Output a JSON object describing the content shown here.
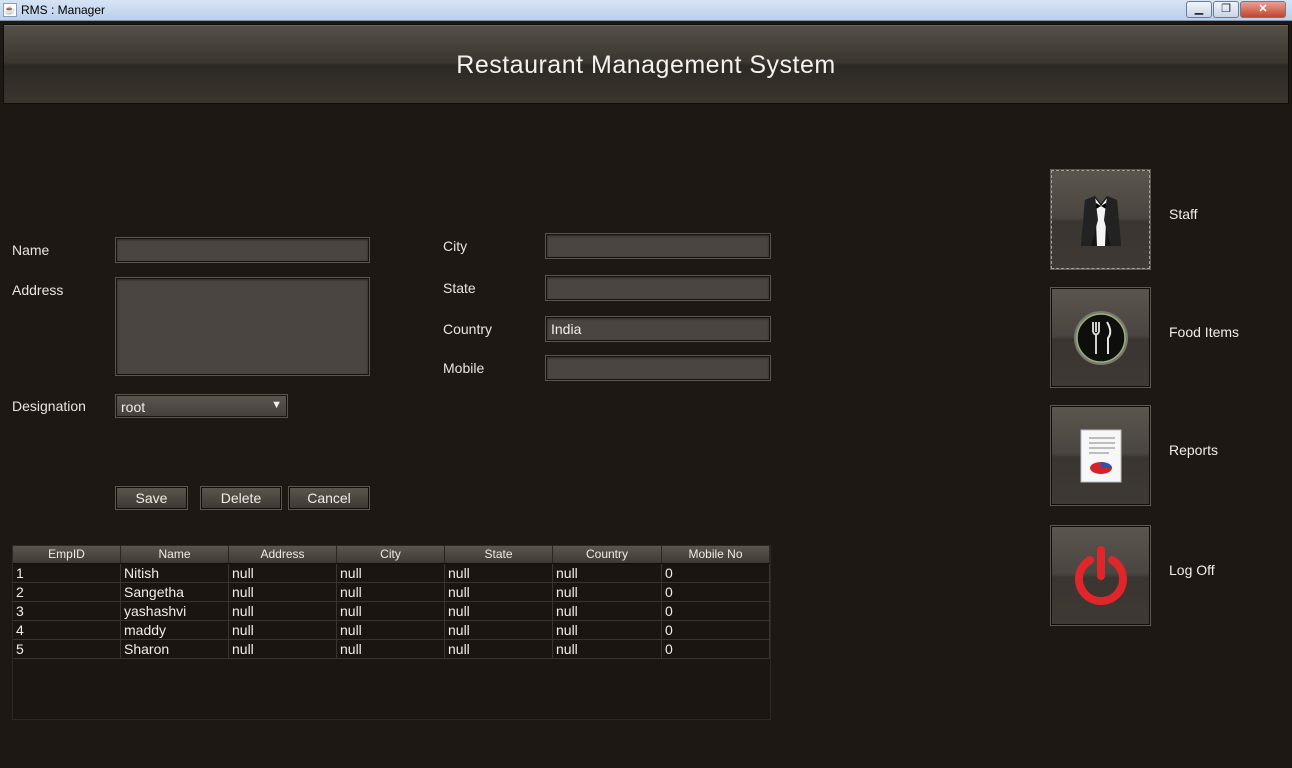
{
  "window": {
    "title": "RMS : Manager"
  },
  "header": {
    "title": "Restaurant Management System"
  },
  "form": {
    "name_label": "Name",
    "address_label": "Address",
    "designation_label": "Designation",
    "city_label": "City",
    "state_label": "State",
    "country_label": "Country",
    "mobile_label": "Mobile",
    "name_value": "",
    "address_value": "",
    "city_value": "",
    "state_value": "",
    "country_value": "India",
    "mobile_value": "",
    "designation_selected": "root"
  },
  "buttons": {
    "save": "Save",
    "delete": "Delete",
    "cancel": "Cancel"
  },
  "table": {
    "columns": [
      "EmpID",
      "Name",
      "Address",
      "City",
      "State",
      "Country",
      "Mobile No"
    ],
    "rows": [
      [
        "1",
        "Nitish",
        "null",
        "null",
        "null",
        "null",
        "0"
      ],
      [
        "2",
        "Sangetha",
        "null",
        "null",
        "null",
        "null",
        "0"
      ],
      [
        "3",
        "yashashvi",
        "null",
        "null",
        "null",
        "null",
        "0"
      ],
      [
        "4",
        "maddy",
        "null",
        "null",
        "null",
        "null",
        "0"
      ],
      [
        "5",
        "Sharon",
        "null",
        "null",
        "null",
        "null",
        "0"
      ]
    ]
  },
  "nav": {
    "staff": "Staff",
    "food_items": "Food Items",
    "reports": "Reports",
    "log_off": "Log Off"
  },
  "icons": {
    "staff": "tuxedo-icon",
    "food_items": "fork-knife-icon",
    "reports": "report-chart-icon",
    "log_off": "power-icon"
  },
  "colors": {
    "background": "#1e1814",
    "power_red": "#e0252b"
  }
}
